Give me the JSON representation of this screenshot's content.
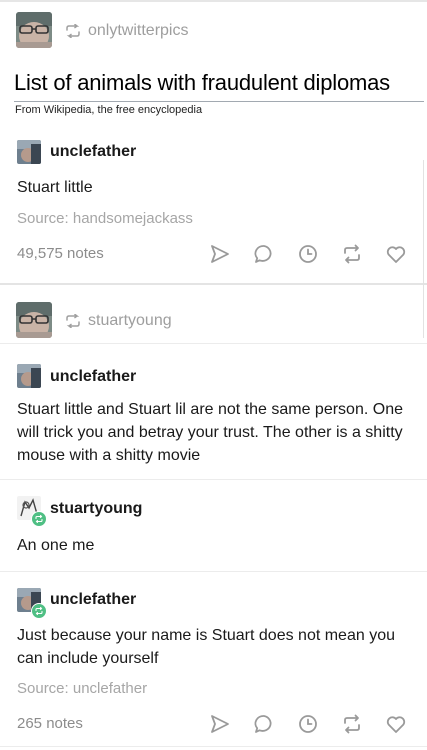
{
  "post1": {
    "reblogged_from": "onlytwitterpics",
    "wiki_title": "List of animals with fraudulent diplomas",
    "wiki_subtitle": "From Wikipedia, the free encyclopedia",
    "author": "unclefather",
    "text": "Stuart little",
    "source": "Source: handsomejackass",
    "notes": "49,575 notes"
  },
  "post2": {
    "reblogged_from": "stuartyoung",
    "entries": [
      {
        "author": "unclefather",
        "text": "Stuart little and Stuart lil are not the same person. One will trick you and betray your trust. The other is a shitty mouse with a shitty movie"
      },
      {
        "author": "stuartyoung",
        "text": "An one me"
      },
      {
        "author": "unclefather",
        "text": "Just because your name is Stuart does not mean you can include yourself"
      }
    ],
    "source": "Source: unclefather",
    "notes": "265 notes"
  },
  "icons": {
    "share": "send-icon",
    "reply": "reply-icon",
    "clock": "queue-icon",
    "reblog": "reblog-icon",
    "like": "heart-icon"
  },
  "colors": {
    "muted_text": "#9e9e9e",
    "reblog_badge": "#4fbf84",
    "icon_gray": "#9a9a9a"
  }
}
